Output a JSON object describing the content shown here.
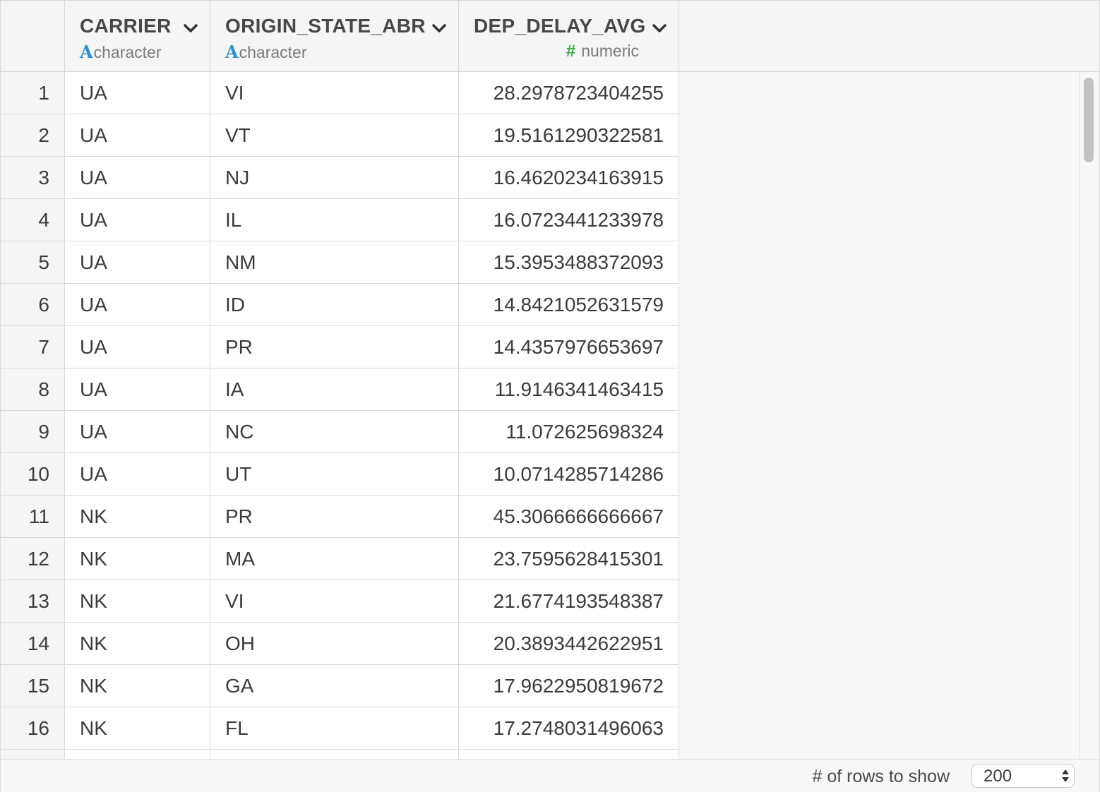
{
  "columns": [
    {
      "name": "CARRIER",
      "type_icon": "A",
      "type": "character"
    },
    {
      "name": "ORIGIN_STATE_ABR",
      "type_icon": "A",
      "type": "character"
    },
    {
      "name": "DEP_DELAY_AVG",
      "type_icon": "#",
      "type": "numeric"
    }
  ],
  "rows": [
    {
      "num": "1",
      "carrier": "UA",
      "state": "VI",
      "delay": "28.2978723404255"
    },
    {
      "num": "2",
      "carrier": "UA",
      "state": "VT",
      "delay": "19.5161290322581"
    },
    {
      "num": "3",
      "carrier": "UA",
      "state": "NJ",
      "delay": "16.4620234163915"
    },
    {
      "num": "4",
      "carrier": "UA",
      "state": "IL",
      "delay": "16.0723441233978"
    },
    {
      "num": "5",
      "carrier": "UA",
      "state": "NM",
      "delay": "15.3953488372093"
    },
    {
      "num": "6",
      "carrier": "UA",
      "state": "ID",
      "delay": "14.8421052631579"
    },
    {
      "num": "7",
      "carrier": "UA",
      "state": "PR",
      "delay": "14.4357976653697"
    },
    {
      "num": "8",
      "carrier": "UA",
      "state": "IA",
      "delay": "11.9146341463415"
    },
    {
      "num": "9",
      "carrier": "UA",
      "state": "NC",
      "delay": "11.072625698324"
    },
    {
      "num": "10",
      "carrier": "UA",
      "state": "UT",
      "delay": "10.0714285714286"
    },
    {
      "num": "11",
      "carrier": "NK",
      "state": "PR",
      "delay": "45.3066666666667"
    },
    {
      "num": "12",
      "carrier": "NK",
      "state": "MA",
      "delay": "23.7595628415301"
    },
    {
      "num": "13",
      "carrier": "NK",
      "state": "VI",
      "delay": "21.6774193548387"
    },
    {
      "num": "14",
      "carrier": "NK",
      "state": "OH",
      "delay": "20.3893442622951"
    },
    {
      "num": "15",
      "carrier": "NK",
      "state": "GA",
      "delay": "17.9622950819672"
    },
    {
      "num": "16",
      "carrier": "NK",
      "state": "FL",
      "delay": "17.2748031496063"
    }
  ],
  "footer": {
    "rows_label": "# of rows to show",
    "rows_value": "200"
  },
  "colors": {
    "character_icon": "#2b8fd6",
    "numeric_icon": "#3aa84a",
    "header_bg": "#f5f5f5",
    "grid": "#d9d9d9"
  },
  "icons": {
    "column_menu": "chevron-down-icon",
    "select_arrows": "up-down-arrows-icon"
  }
}
